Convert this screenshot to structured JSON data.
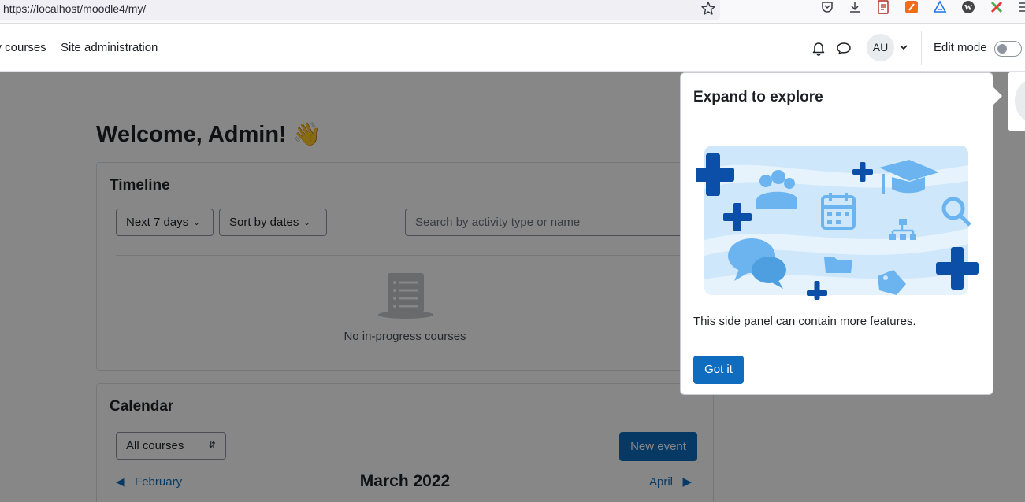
{
  "browser": {
    "url": "https://localhost/moodle4/my/",
    "icons": [
      "bookmark-star-icon",
      "pocket-icon",
      "download-icon",
      "reader-icon",
      "extension-orange-icon",
      "extension-triangle-icon",
      "wordpress-icon",
      "extension-x-icon",
      "menu-icon"
    ]
  },
  "navbar": {
    "my_courses": "My courses",
    "site_admin": "Site administration",
    "avatar_initials": "AU",
    "edit_mode_label": "Edit mode"
  },
  "page": {
    "welcome": "Welcome, Admin! 👋",
    "timeline": {
      "title": "Timeline",
      "filter_label": "Next 7 days",
      "sort_label": "Sort by dates",
      "search_placeholder": "Search by activity type or name",
      "empty_text": "No in-progress courses"
    },
    "calendar": {
      "title": "Calendar",
      "course_select": "All courses",
      "new_event": "New event",
      "prev_month": "February",
      "current_month": "March 2022",
      "next_month": "April"
    }
  },
  "tour": {
    "title": "Expand to explore",
    "text": "This side panel can contain more features.",
    "button": "Got it"
  },
  "colors": {
    "primary": "#0f6cbf",
    "illustration_dark": "#0b4fa8",
    "illustration_light": "#9fd0f5",
    "illustration_bg": "#cfe7fb"
  }
}
